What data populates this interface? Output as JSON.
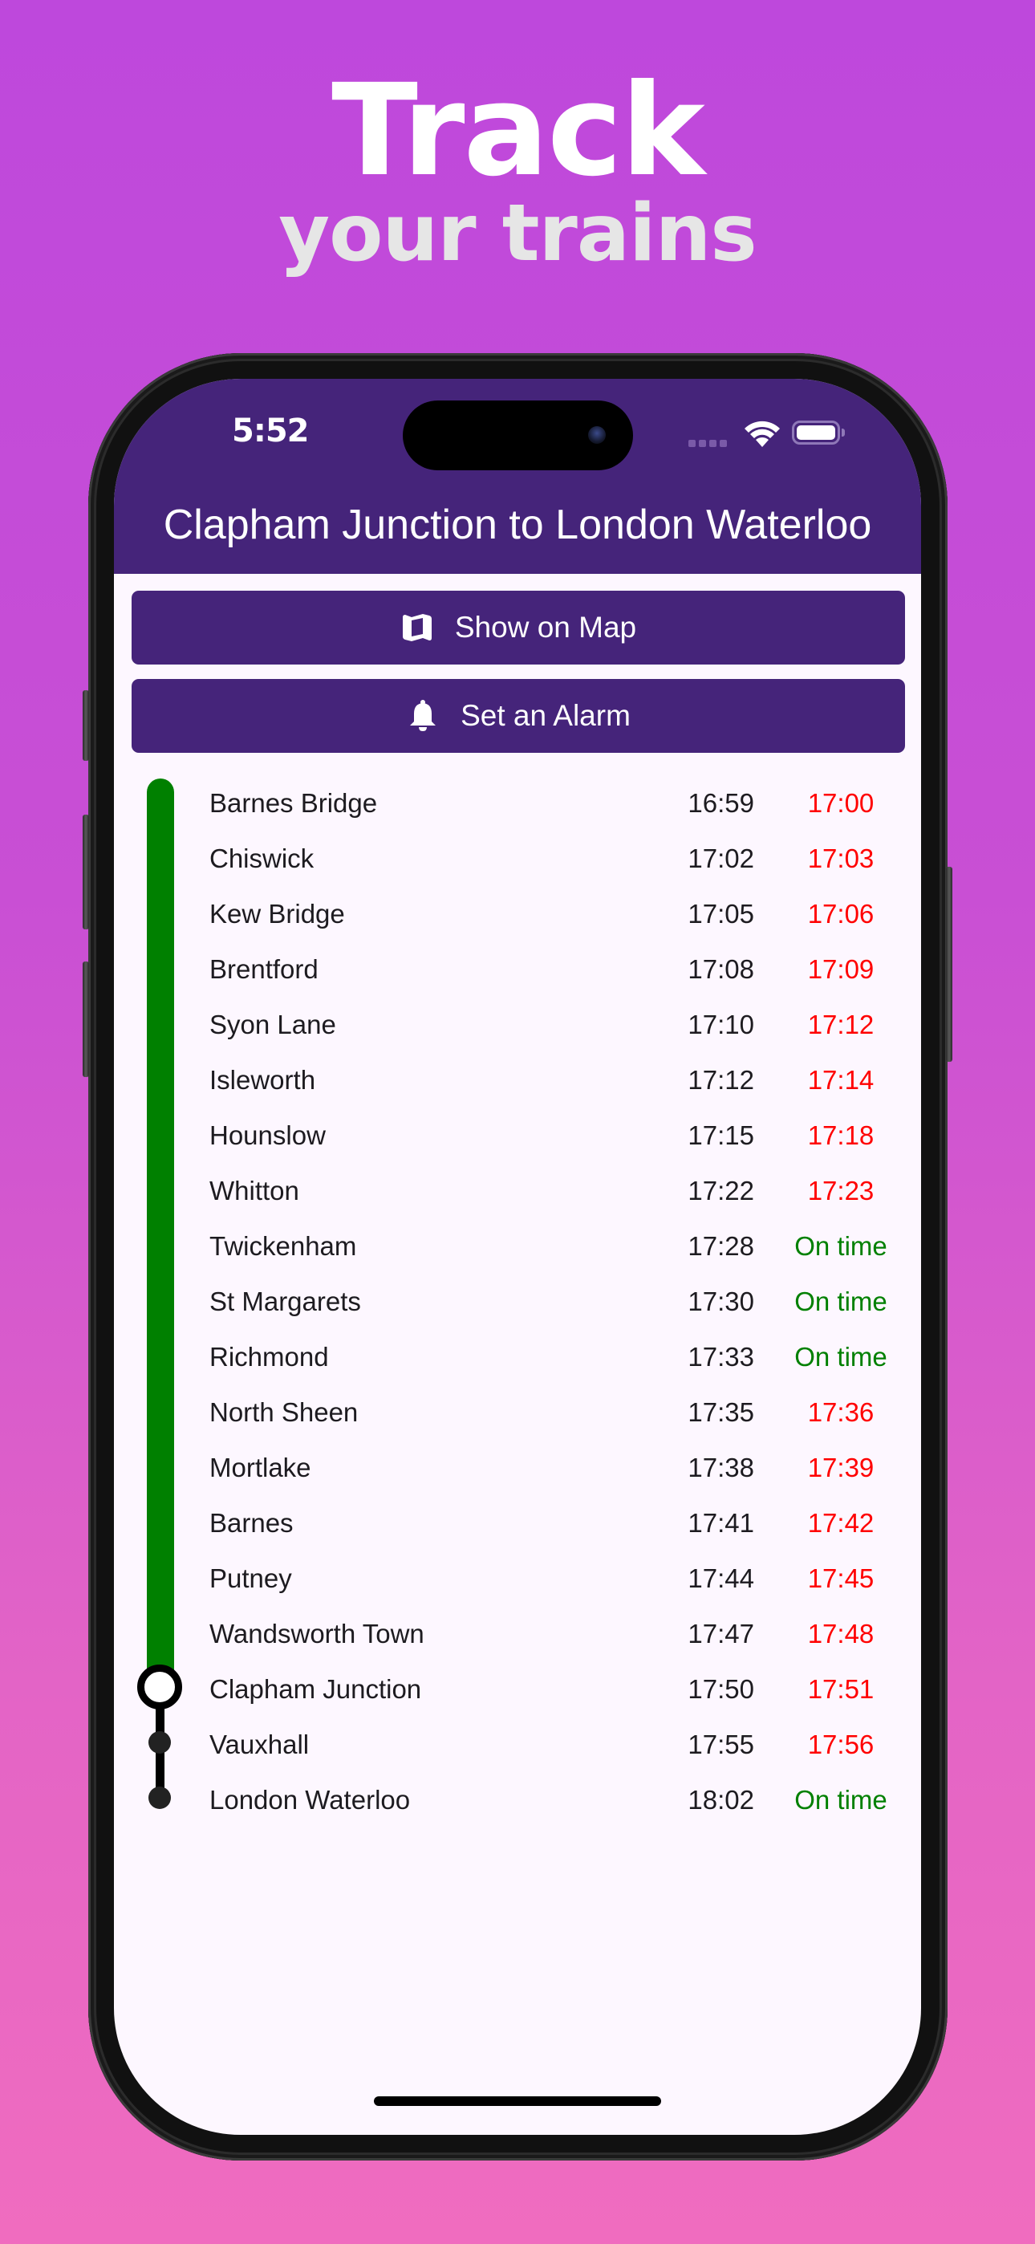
{
  "promo": {
    "headline": "Track",
    "subheadline": "your trains"
  },
  "status_bar": {
    "time": "5:52",
    "icons": [
      "cellular-signal-icon",
      "wifi-icon",
      "battery-icon"
    ]
  },
  "app_bar": {
    "title": "Clapham Junction to London Waterloo"
  },
  "actions": [
    {
      "label": "Show on Map",
      "icon": "map-icon"
    },
    {
      "label": "Set an Alarm",
      "icon": "bell-icon"
    }
  ],
  "colors": {
    "primary": "#45247a",
    "late": "#ff0000",
    "on_time": "#008000",
    "travelled_line": "#008000",
    "upcoming_line": "#000000"
  },
  "current_station": "Clapham Junction",
  "stops": [
    {
      "station": "Barnes Bridge",
      "scheduled": "16:59",
      "actual": "17:00",
      "status": "late",
      "segment": "passed"
    },
    {
      "station": "Chiswick",
      "scheduled": "17:02",
      "actual": "17:03",
      "status": "late",
      "segment": "passed"
    },
    {
      "station": "Kew Bridge",
      "scheduled": "17:05",
      "actual": "17:06",
      "status": "late",
      "segment": "passed"
    },
    {
      "station": "Brentford",
      "scheduled": "17:08",
      "actual": "17:09",
      "status": "late",
      "segment": "passed"
    },
    {
      "station": "Syon Lane",
      "scheduled": "17:10",
      "actual": "17:12",
      "status": "late",
      "segment": "passed"
    },
    {
      "station": "Isleworth",
      "scheduled": "17:12",
      "actual": "17:14",
      "status": "late",
      "segment": "passed"
    },
    {
      "station": "Hounslow",
      "scheduled": "17:15",
      "actual": "17:18",
      "status": "late",
      "segment": "passed"
    },
    {
      "station": "Whitton",
      "scheduled": "17:22",
      "actual": "17:23",
      "status": "late",
      "segment": "passed"
    },
    {
      "station": "Twickenham",
      "scheduled": "17:28",
      "actual": "On time",
      "status": "ontime",
      "segment": "passed"
    },
    {
      "station": "St Margarets",
      "scheduled": "17:30",
      "actual": "On time",
      "status": "ontime",
      "segment": "passed"
    },
    {
      "station": "Richmond",
      "scheduled": "17:33",
      "actual": "On time",
      "status": "ontime",
      "segment": "passed"
    },
    {
      "station": "North Sheen",
      "scheduled": "17:35",
      "actual": "17:36",
      "status": "late",
      "segment": "passed"
    },
    {
      "station": "Mortlake",
      "scheduled": "17:38",
      "actual": "17:39",
      "status": "late",
      "segment": "passed"
    },
    {
      "station": "Barnes",
      "scheduled": "17:41",
      "actual": "17:42",
      "status": "late",
      "segment": "passed"
    },
    {
      "station": "Putney",
      "scheduled": "17:44",
      "actual": "17:45",
      "status": "late",
      "segment": "passed"
    },
    {
      "station": "Wandsworth Town",
      "scheduled": "17:47",
      "actual": "17:48",
      "status": "late",
      "segment": "passed"
    },
    {
      "station": "Clapham Junction",
      "scheduled": "17:50",
      "actual": "17:51",
      "status": "late",
      "segment": "current"
    },
    {
      "station": "Vauxhall",
      "scheduled": "17:55",
      "actual": "17:56",
      "status": "late",
      "segment": "upcoming"
    },
    {
      "station": "London Waterloo",
      "scheduled": "18:02",
      "actual": "On time",
      "status": "ontime",
      "segment": "upcoming"
    }
  ]
}
